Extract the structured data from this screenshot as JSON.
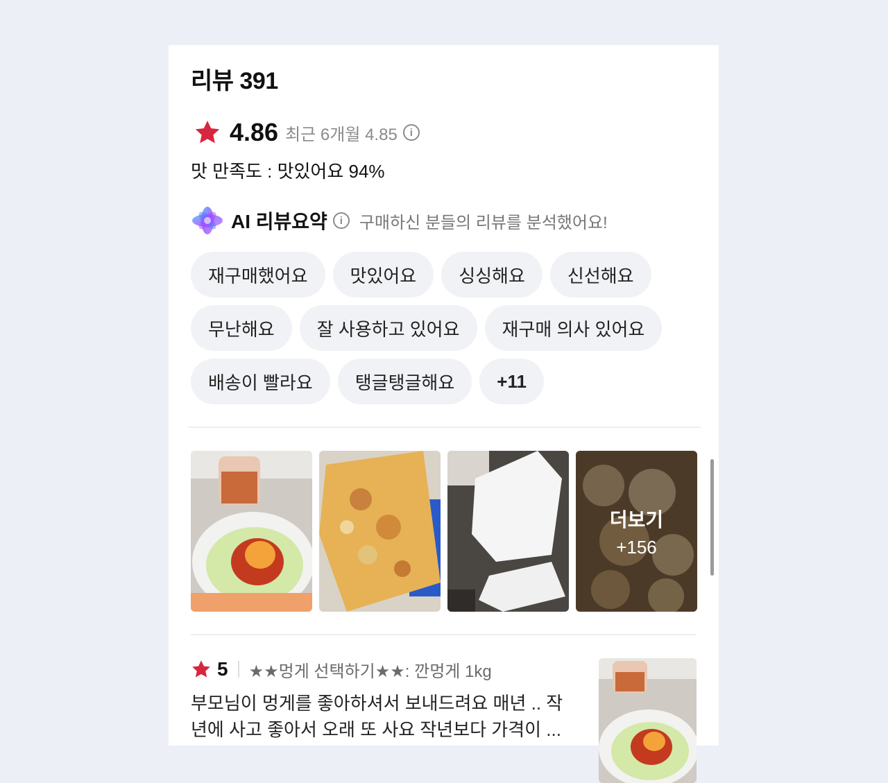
{
  "review": {
    "title": "리뷰 391",
    "rating": "4.86",
    "recent_label": "최근 6개월 4.85",
    "satisfaction": "맛 만족도 : 맛있어요 94%"
  },
  "ai_summary": {
    "title": "AI 리뷰요약",
    "description": "구매하신 분들의 리뷰를 분석했어요!",
    "tags": [
      "재구매했어요",
      "맛있어요",
      "싱싱해요",
      "신선해요",
      "무난해요",
      "잘 사용하고 있어요",
      "재구매 의사 있어요",
      "배송이 빨라요",
      "탱글탱글해요"
    ],
    "more_tags": "+11"
  },
  "photos": {
    "more_label": "더보기",
    "more_count": "+156"
  },
  "review_item": {
    "score": "5",
    "option": "★★멍게 선택하기★★: 깐멍게 1kg",
    "text": "부모님이 멍게를 좋아하셔서 보내드려요 매년 .. 작년에 사고 좋아서 오래 또 사요 작년보다 가격이 ..."
  },
  "colors": {
    "star": "#d7263d",
    "tag_bg": "#f1f2f5",
    "page_bg": "#eceff6"
  },
  "icons": [
    "star-icon",
    "info-icon",
    "ai-sparkle-icon"
  ]
}
